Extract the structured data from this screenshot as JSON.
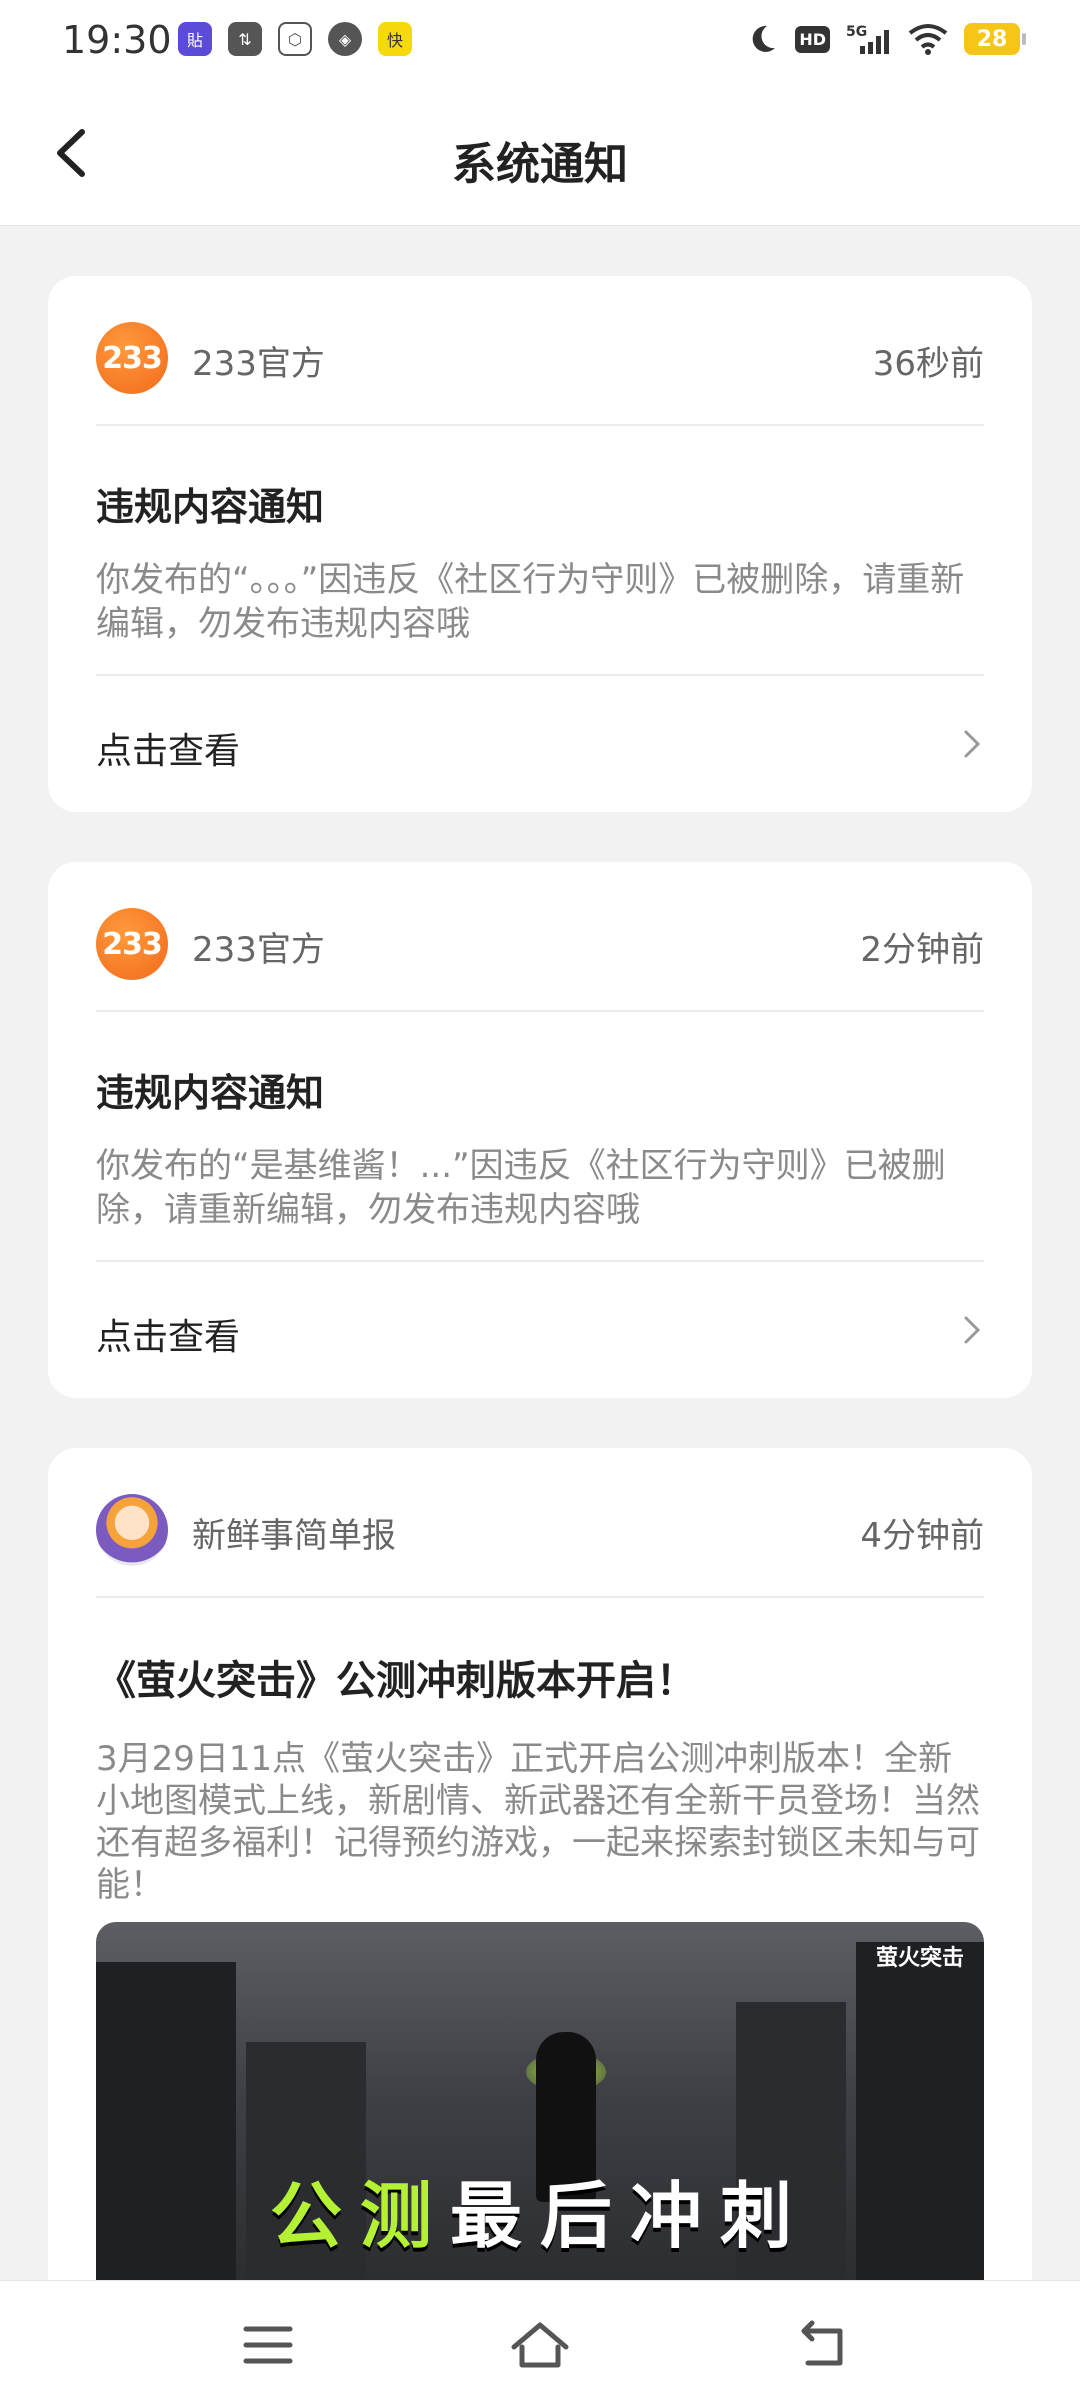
{
  "status_bar": {
    "time": "19:30",
    "battery": "28",
    "icons_left": [
      "app-icon",
      "transfer-icon",
      "hex-icon",
      "compass-icon",
      "yellow-app-icon"
    ],
    "icons_right": [
      "moon-icon",
      "hd-icon",
      "signal-5g-icon",
      "wifi-icon",
      "battery-icon"
    ]
  },
  "header": {
    "title": "系统通知"
  },
  "notifications": [
    {
      "sender": "233官方",
      "avatar_text": "233",
      "time": "36秒前",
      "title": "违规内容通知",
      "body": "你发布的“。。。”因违反《社区行为守则》已被删除，请重新编辑，勿发布违规内容哦",
      "action": "点击查看"
    },
    {
      "sender": "233官方",
      "avatar_text": "233",
      "time": "2分钟前",
      "title": "违规内容通知",
      "body": "你发布的“是基维酱！...”因违反《社区行为守则》已被删除，请重新编辑，勿发布违规内容哦",
      "action": "点击查看"
    },
    {
      "sender": "新鲜事简单报",
      "time": "4分钟前",
      "title": "《萤火突击》公测冲刺版本开启！",
      "body": "3月29日11点《萤火突击》正式开启公测冲刺版本！全新小地图模式上线，新剧情、新武器还有全新干员登场！当然还有超多福利！记得预约游戏，一起来探索封锁区未知与可能！",
      "banner": {
        "logo": "萤火突击",
        "headline_accent": "公测",
        "headline_rest": "最后冲刺"
      }
    }
  ],
  "nav_bar": {
    "icons": [
      "menu-icon",
      "home-icon",
      "back-icon"
    ]
  },
  "colors": {
    "accent_orange": "#f26a1b",
    "lime": "#b4f034"
  }
}
